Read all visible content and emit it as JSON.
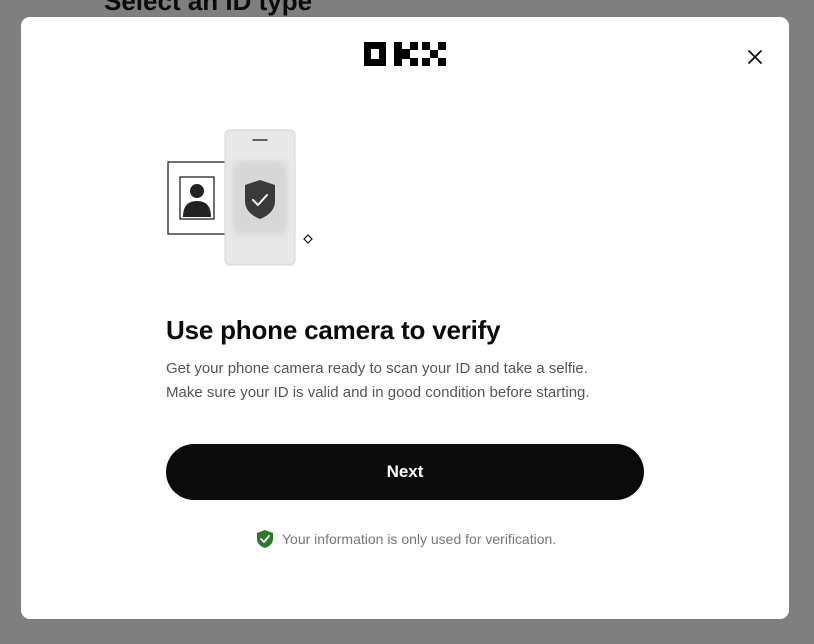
{
  "background": {
    "title": "Select an ID type"
  },
  "modal": {
    "logo_text": "OKX",
    "close_icon": "close-icon",
    "illustration": {
      "icons": [
        "id-card-icon",
        "person-silhouette-icon",
        "phone-icon",
        "shield-check-icon",
        "diamond-icon"
      ]
    },
    "title": "Use phone camera to verify",
    "description": [
      "Get your phone camera ready to scan your ID and take a selfie.",
      "Make sure your ID is valid and in good condition before starting."
    ],
    "next_label": "Next",
    "privacy_note": "Your information is only used for verification.",
    "privacy_icon": "shield-check-icon"
  },
  "colors": {
    "overlay": "#7f7f7f",
    "primary_button": "#0b0b0b",
    "shield_green": "#2f7a2a"
  }
}
